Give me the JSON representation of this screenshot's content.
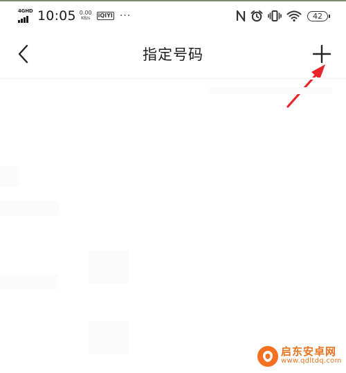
{
  "status_bar": {
    "network_type": "4GHD",
    "time": "10:05",
    "speed_value": "0.00",
    "speed_unit": "KB/s",
    "app_badge": "iQIYI",
    "more": "···",
    "battery": "42",
    "icons": [
      "nfc-icon",
      "alarm-icon",
      "vibrate-icon",
      "wifi-icon",
      "battery-icon"
    ]
  },
  "nav": {
    "title": "指定号码",
    "back_icon": "chevron-left-icon",
    "add_icon": "plus-icon"
  },
  "annotation": {
    "arrow_color": "#e8262a"
  },
  "watermark": {
    "name": "启东安卓网",
    "url": "www.qdltdq.com",
    "color": "#e8731f"
  }
}
